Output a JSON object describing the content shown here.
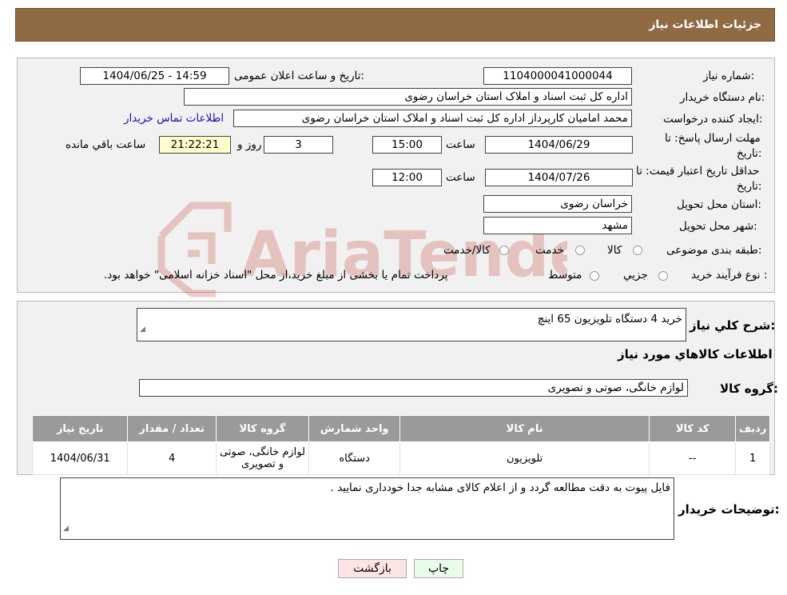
{
  "header": {
    "title": "جزئیات اطلاعات نیاز"
  },
  "form": {
    "need_number_label": "شماره نیاز:",
    "need_number": "1104000041000044",
    "announce_label": "تاریخ و ساعت اعلان عمومی:",
    "announce_value": "1404/06/25 - 14:59",
    "buyer_label": "نام دستگاه خریدار:",
    "buyer_value": "اداره کل ثبت اسناد و املاک استان خراسان رضوی",
    "creator_label": "ایجاد کننده درخواست:",
    "creator_value": "محمد امامیان کارپرداز اداره کل ثبت اسناد و املاک استان خراسان رضوی",
    "contact_link": "اطلاعات تماس خریدار",
    "deadline_label_1": "مهلت ارسال پاسخ: تا",
    "deadline_label_2": "تاریخ:",
    "deadline_date": "1404/06/29",
    "time_label": "ساعت",
    "deadline_time": "15:00",
    "days_value": "3",
    "days_label": "روز و",
    "remaining_time": "21:22:21",
    "remaining_label": "ساعت باقي مانده",
    "validity_label_1": "حداقل تاریخ اعتبار قیمت: تا",
    "validity_label_2": "تاریخ:",
    "validity_date": "1404/07/26",
    "validity_time_label": "ساعت",
    "validity_time": "12:00",
    "province_label": "استان محل تحویل:",
    "province_value": "خراسان رضوی",
    "city_label": "شهر محل تحویل:",
    "city_value": "مشهد",
    "category_label": "طبقه بندی موضوعی:",
    "category_options": [
      "کالا",
      "خدمت",
      "کالا/خدمت"
    ],
    "process_label": "نوع فرآیند خرید :",
    "process_options": [
      "جزیي",
      "متوسط"
    ],
    "process_note": "پرداخت تمام یا بخشی از مبلغ خرید،از محل \"اسناد خزانه اسلامی\" خواهد بود."
  },
  "summary": {
    "label": "شرح کلي نیاز:",
    "value": "خرید  4 دستگاه تلویزیون 65  اینچ",
    "goods_info_title": "اطلاعات کالاهاي مورد نیاز",
    "group_label": "گروه کالا:",
    "group_value": "لوازم خانگی، صوتی و تصویری"
  },
  "table": {
    "headers": [
      "ردیف",
      "کد کالا",
      "نام کالا",
      "واحد شمارش",
      "گروه کالا",
      "تعداد / مقدار",
      "تاریخ نیاز"
    ],
    "rows": [
      [
        "1",
        "--",
        "تلویزیون",
        "دستگاه",
        "لوازم خانگی، صوتی و تصویری",
        "4",
        "1404/06/31"
      ]
    ]
  },
  "notes": {
    "label": "توضیحات خریدار:",
    "value": "فایل پیوت به دقت مطالعه گردد و از اعلام کالای مشابه جدا خودداری نمایید ."
  },
  "buttons": {
    "print": "چاپ",
    "back": "بازگشت"
  },
  "watermark": {
    "text": "AriaTender.neT",
    "color": "#c0392b"
  }
}
